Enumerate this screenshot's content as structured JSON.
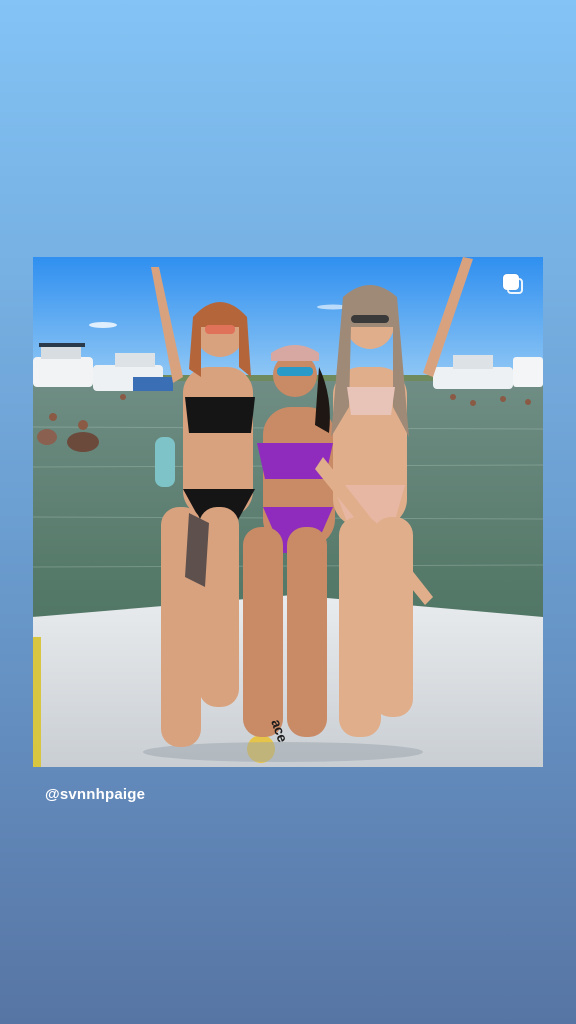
{
  "story": {
    "background_top": "#83c3f5",
    "background_bottom": "#5775a4"
  },
  "post": {
    "image": "repost-photo",
    "author": "@svnnhpaige",
    "board_text": "ace"
  },
  "icons": {
    "repost": "repost-square-icon"
  }
}
